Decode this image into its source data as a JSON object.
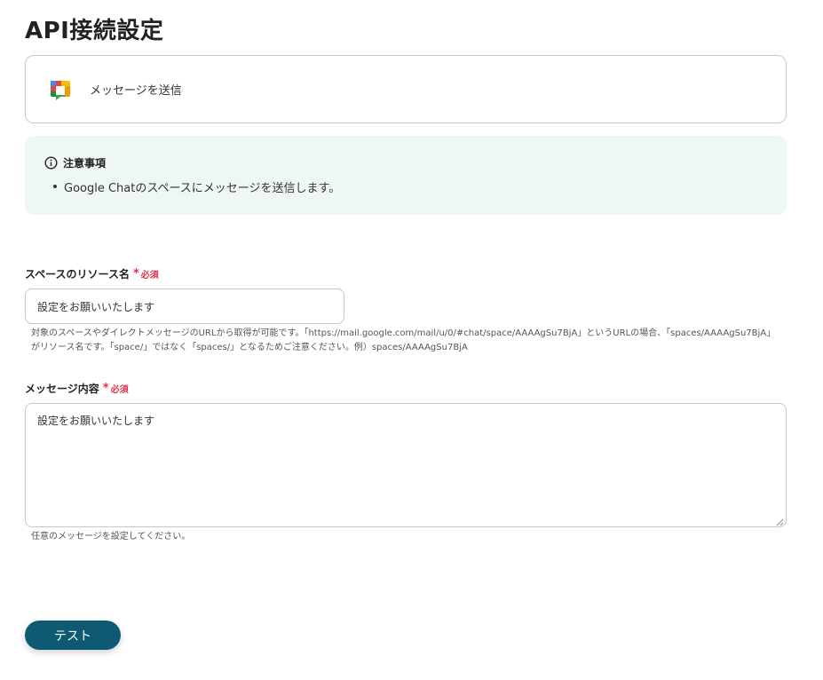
{
  "page": {
    "title": "API接続設定"
  },
  "action": {
    "icon": "google-chat-icon",
    "label": "メッセージを送信"
  },
  "notice": {
    "icon": "info-icon",
    "heading": "注意事項",
    "items": [
      "Google Chatのスペースにメッセージを送信します。"
    ]
  },
  "fields": {
    "space": {
      "label": "スペースのリソース名",
      "required_mark": "*",
      "required_text": "必須",
      "value": "設定をお願いいたします",
      "help_line1": "対象のスペースやダイレクトメッセージのURLから取得が可能です。「https://mail.google.com/mail/u/0/#chat/space/AAAAgSu7BjA」というURLの場合、「spaces/AAAAgSu7BjA」",
      "help_line2": "がリソース名です。「space/」ではなく「spaces/」となるためご注意ください。例）spaces/AAAAgSu7BjA"
    },
    "message": {
      "label": "メッセージ内容",
      "required_mark": "*",
      "required_text": "必須",
      "value": "設定をお願いいたします",
      "help": "任意のメッセージを設定してください。"
    }
  },
  "buttons": {
    "test_label": "テスト"
  },
  "colors": {
    "accent": "#0e5a72",
    "required": "#e0324b",
    "notice_bg": "#eef7f4"
  }
}
